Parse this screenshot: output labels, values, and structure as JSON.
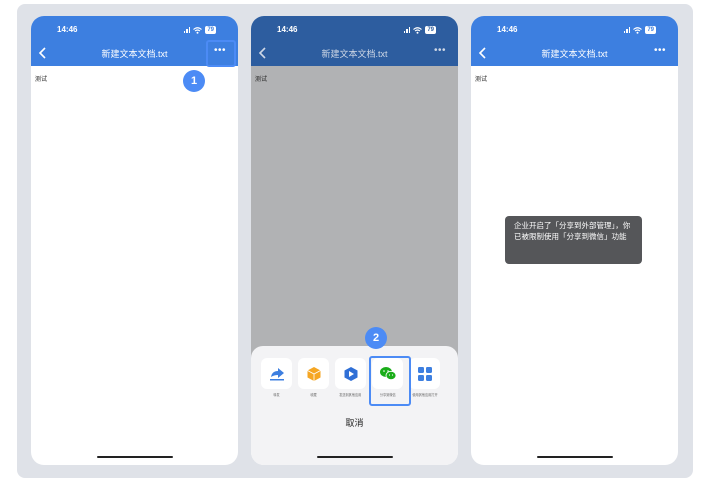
{
  "phones": [
    {
      "time": "14:46",
      "battery": "79",
      "title": "新建文本文档.txt",
      "content": "测试",
      "more": "•••"
    },
    {
      "time": "14:46",
      "battery": "79",
      "title": "新建文本文档.txt",
      "content": "测试",
      "more": "•••"
    },
    {
      "time": "14:46",
      "battery": "79",
      "title": "新建文本文档.txt",
      "content": "测试",
      "more": "•••"
    }
  ],
  "steps": {
    "step1": "1",
    "step2": "2"
  },
  "share_sheet": {
    "items": [
      {
        "label": "转发",
        "icon": "forward-icon"
      },
      {
        "label": "收藏",
        "icon": "collect-icon"
      },
      {
        "label": "发送到其他应用",
        "icon": "app-icon"
      },
      {
        "label": "分享到微信",
        "icon": "wechat-icon"
      },
      {
        "label": "使用其他应用打开",
        "icon": "grid-icon"
      }
    ],
    "cancel": "取消"
  },
  "toast": "企业开启了「分享到外部管理」，你已被限制使用「分享到微信」功能",
  "colors": {
    "header_blue": "#3d7fe0",
    "header_dimmed": "#2d5d9f",
    "highlight_blue": "#4c8bf5",
    "wechat_green": "#1aad19"
  }
}
